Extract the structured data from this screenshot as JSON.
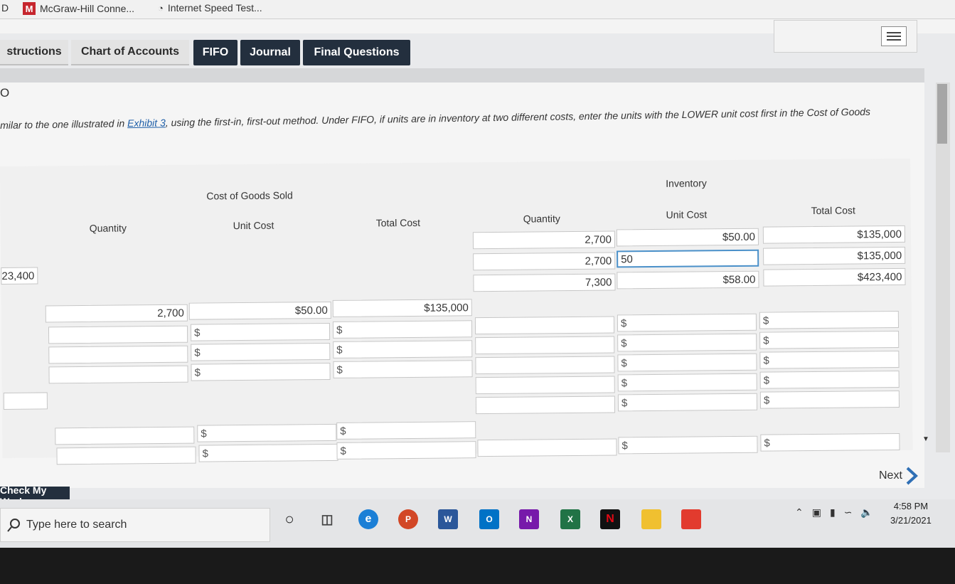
{
  "bookmarks": {
    "item1_prefix": "D",
    "item2": "McGraw-Hill Conne...",
    "item3": "Internet Speed Test..."
  },
  "tabs": [
    "structions",
    "Chart of Accounts",
    "FIFO",
    "Journal",
    "Final Questions"
  ],
  "step_label": "O",
  "instruction": {
    "before_link": "milar to the one illustrated in ",
    "link": "Exhibit 3",
    "after_link": ", using the first-in, first-out method. Under FIFO, if units are in inventory at two different costs, enter the units with the LOWER unit cost first in the Cost of Goods"
  },
  "table": {
    "group_cogs": "Cost of Goods Sold",
    "group_inventory": "Inventory",
    "col_quantity": "Quantity",
    "col_unit_cost": "Unit Cost",
    "col_total_cost": "Total Cost",
    "left_value": "23,400",
    "inventory_rows": [
      {
        "qty": "2,700",
        "unit": "$50.00",
        "total": "$135,000"
      },
      {
        "qty": "2,700",
        "unit": "50",
        "total": "$135,000"
      },
      {
        "qty": "7,300",
        "unit": "$58.00",
        "total": "$423,400"
      }
    ],
    "cogs_row": {
      "qty": "2,700",
      "unit": "$50.00",
      "total": "$135,000"
    },
    "currency": "$"
  },
  "buttons": {
    "check": "Check My Work",
    "next": "Next"
  },
  "taskbar": {
    "search_placeholder": "Type here to search",
    "time": "4:58 PM",
    "date": "3/21/2021"
  },
  "icons": [
    "menu-icon",
    "search-icon",
    "cortana-icon",
    "taskview-icon",
    "edge-icon",
    "powerpoint-icon",
    "word-icon",
    "outlook-icon",
    "onenote-icon",
    "excel-icon",
    "netflix-icon",
    "file-explorer-icon",
    "roblox-icon"
  ],
  "colors": {
    "tab_dark": "#232f3e",
    "link": "#1f5fa8",
    "focus": "#4a90c9"
  }
}
